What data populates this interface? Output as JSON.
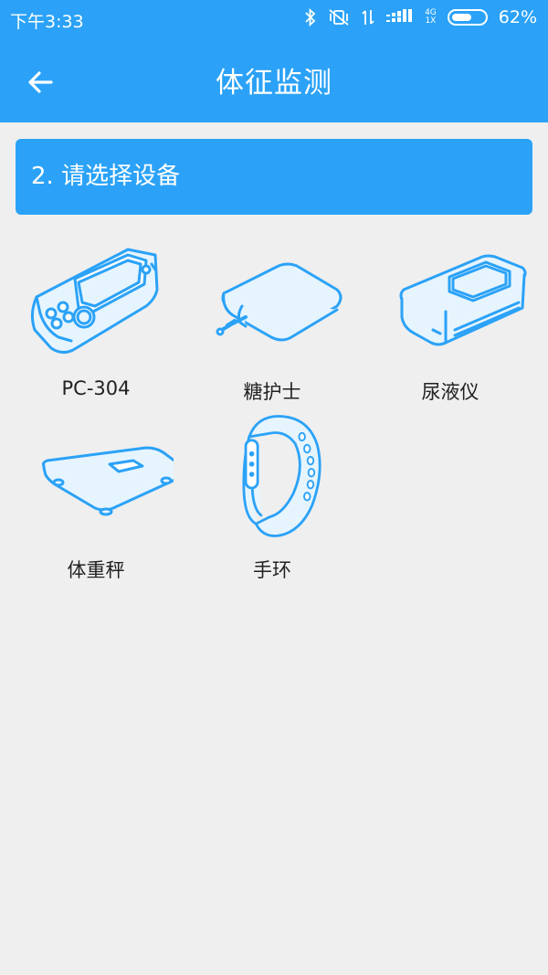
{
  "status_bar": {
    "time": "下午3:33",
    "network_top": "4G",
    "network_bottom": "1X",
    "battery_percent": "62%",
    "battery_level": 0.62,
    "icons": [
      "bluetooth-icon",
      "vibrate-off-icon",
      "data-transfer-icon",
      "signal-icon",
      "battery-icon"
    ]
  },
  "toolbar": {
    "title": "体征监测",
    "back_icon": "arrow-left-icon"
  },
  "step": {
    "label": "2. 请选择设备"
  },
  "devices": [
    {
      "id": "pc304",
      "label": "PC-304",
      "icon": "pc304-monitor-icon"
    },
    {
      "id": "glucose",
      "label": "糖护士",
      "icon": "glucose-meter-icon"
    },
    {
      "id": "urine",
      "label": "尿液仪",
      "icon": "urine-analyzer-icon"
    },
    {
      "id": "scale",
      "label": "体重秤",
      "icon": "weight-scale-icon"
    },
    {
      "id": "band",
      "label": "手环",
      "icon": "wristband-icon"
    }
  ],
  "colors": {
    "primary": "#2ba2f7",
    "background": "#efefef",
    "icon_stroke": "#2ba2f7",
    "icon_fill": "#e6f4fe"
  }
}
